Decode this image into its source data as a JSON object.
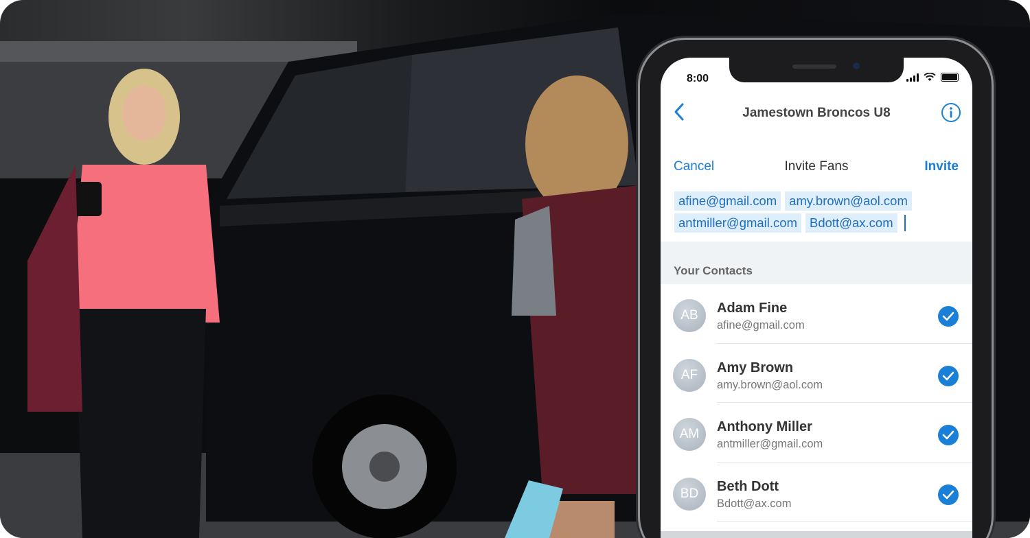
{
  "status": {
    "time": "8:00"
  },
  "nav": {
    "title": "Jamestown Broncos U8"
  },
  "invite": {
    "cancel": "Cancel",
    "title": "Invite Fans",
    "invite": "Invite"
  },
  "recipients": [
    "afine@gmail.com",
    "amy.brown@aol.com",
    "antmiller@gmail.com",
    "Bdott@ax.com"
  ],
  "section": {
    "label": "Your Contacts"
  },
  "contacts": [
    {
      "initials": "AB",
      "name": "Adam Fine",
      "email": "afine@gmail.com",
      "selected": true
    },
    {
      "initials": "AF",
      "name": "Amy Brown",
      "email": "amy.brown@aol.com",
      "selected": true
    },
    {
      "initials": "AM",
      "name": "Anthony Miller",
      "email": "antmiller@gmail.com",
      "selected": true
    },
    {
      "initials": "BD",
      "name": "Beth Dott",
      "email": "Bdott@ax.com",
      "selected": true
    }
  ],
  "colors": {
    "accent": "#1a7fd6",
    "chip_bg": "#dfeefb"
  }
}
